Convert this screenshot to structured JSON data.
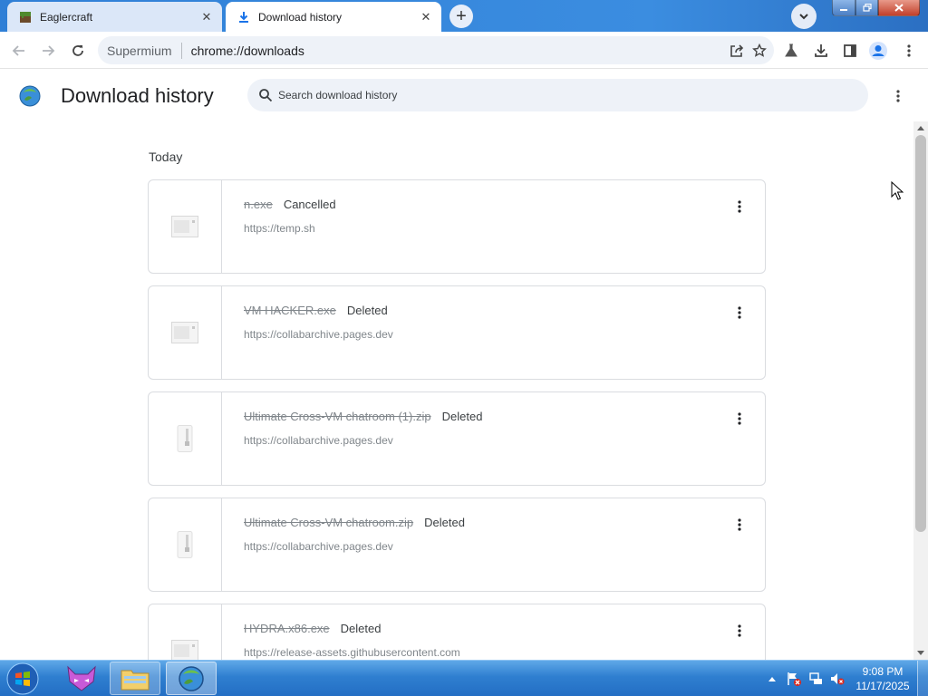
{
  "browser": {
    "tabs": [
      {
        "title": "Eaglercraft",
        "favicon": "grass-block-icon",
        "active": false
      },
      {
        "title": "Download history",
        "favicon": "download-icon",
        "active": true
      }
    ],
    "new_tab_symbol": "+",
    "address": {
      "chip": "Supermium",
      "url": "chrome://downloads"
    }
  },
  "downloads": {
    "title": "Download history",
    "search_placeholder": "Search download history",
    "section_today": "Today",
    "items": [
      {
        "filename": "n.exe",
        "status": "Cancelled",
        "url": "https://temp.sh",
        "icon": "generic-file-icon"
      },
      {
        "filename": "VM HACKER.exe",
        "status": "Deleted",
        "url": "https://collabarchive.pages.dev",
        "icon": "generic-file-icon"
      },
      {
        "filename": "Ultimate Cross-VM chatroom (1).zip",
        "status": "Deleted",
        "url": "https://collabarchive.pages.dev",
        "icon": "zip-file-icon"
      },
      {
        "filename": "Ultimate Cross-VM chatroom.zip",
        "status": "Deleted",
        "url": "https://collabarchive.pages.dev",
        "icon": "zip-file-icon"
      },
      {
        "filename": "HYDRA.x86.exe",
        "status": "Deleted",
        "url": "https://release-assets.githubusercontent.com",
        "icon": "generic-file-icon"
      }
    ]
  },
  "taskbar": {
    "clock_time": "9:08 PM",
    "clock_date": "11/17/2025"
  },
  "colors": {
    "accent": "#1a73e8",
    "tabstrip": "#3b8de0",
    "taskbar": "#2f7fd0"
  }
}
